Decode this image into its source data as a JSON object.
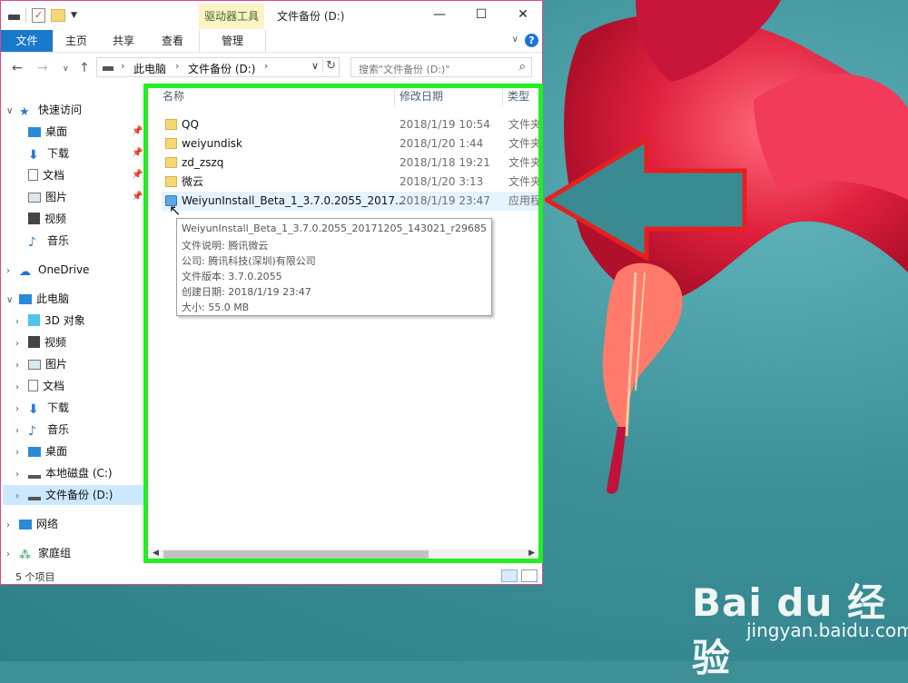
{
  "window": {
    "title": "文件备份 (D:)",
    "context_tab": "驱动器工具",
    "controls": {
      "minimize": "—",
      "maximize": "☐",
      "close": "✕"
    }
  },
  "ribbon": {
    "tabs": [
      "文件",
      "主页",
      "共享",
      "查看",
      "管理"
    ],
    "help": "?"
  },
  "address": {
    "crumbs": [
      "此电脑",
      "文件备份 (D:)"
    ],
    "search_placeholder": "搜索\"文件备份 (D:)\""
  },
  "nav": {
    "quick_access": "快速访问",
    "quick_items": [
      "桌面",
      "下载",
      "文档",
      "图片",
      "视频",
      "音乐"
    ],
    "onedrive": "OneDrive",
    "this_pc": "此电脑",
    "pc_items": [
      "3D 对象",
      "视频",
      "图片",
      "文档",
      "下载",
      "音乐",
      "桌面",
      "本地磁盘 (C:)",
      "文件备份 (D:)"
    ],
    "network": "网络",
    "homegroup": "家庭组"
  },
  "columns": {
    "name": "名称",
    "date": "修改日期",
    "type": "类型"
  },
  "files": [
    {
      "name": "QQ",
      "date": "2018/1/19 10:54",
      "type": "文件夹"
    },
    {
      "name": "weiyundisk",
      "date": "2018/1/20 1:44",
      "type": "文件夹"
    },
    {
      "name": "zd_zszq",
      "date": "2018/1/18 19:21",
      "type": "文件夹"
    },
    {
      "name": "微云",
      "date": "2018/1/20 3:13",
      "type": "文件夹"
    },
    {
      "name": "WeiyunInstall_Beta_1_3.7.0.2055_2017...",
      "date": "2018/1/19 23:47",
      "type": "应用程"
    }
  ],
  "tooltip": [
    "WeiyunInstall_Beta_1_3.7.0.2055_20171205_143021_r29685",
    "文件说明: 腾讯微云",
    "公司: 腾讯科技(深圳)有限公司",
    "文件版本: 3.7.0.2055",
    "创建日期: 2018/1/19 23:47",
    "大小: 55.0 MB"
  ],
  "status": {
    "count": "5 个项目"
  },
  "watermark": {
    "logo": "Bai du 经验",
    "url": "jingyan.baidu.com"
  },
  "colors": {
    "accent": "#1979ca",
    "highlight_box": "#22ee22",
    "arrow": "#e52020"
  }
}
